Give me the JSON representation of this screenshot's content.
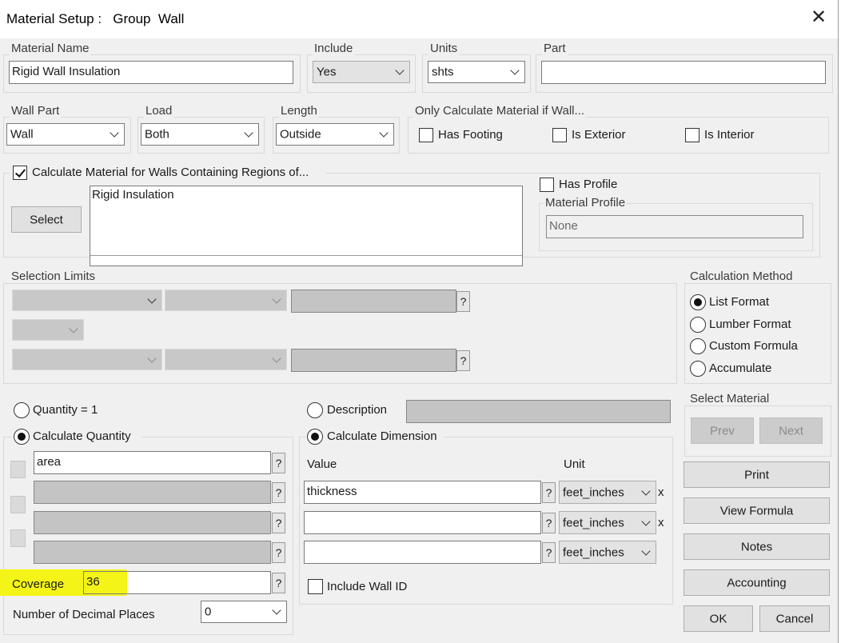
{
  "dialog": {
    "title": "Material Setup :   Group  Wall"
  },
  "material_name": {
    "label": "Material Name",
    "value": "Rigid Wall Insulation"
  },
  "include": {
    "label": "Include",
    "value": "Yes"
  },
  "units": {
    "label": "Units",
    "value": "shts"
  },
  "part": {
    "label": "Part",
    "value": ""
  },
  "wall_part": {
    "label": "Wall Part",
    "value": "Wall"
  },
  "load": {
    "label": "Load",
    "value": "Both"
  },
  "length": {
    "label": "Length",
    "value": "Outside"
  },
  "only_calc": {
    "label": "Only Calculate Material if Wall...",
    "has_footing": {
      "label": "Has Footing",
      "checked": false
    },
    "is_exterior": {
      "label": "Is Exterior",
      "checked": false
    },
    "is_interior": {
      "label": "Is Interior",
      "checked": false
    }
  },
  "regions": {
    "checkbox_label": "Calculate Material for Walls Containing Regions of...",
    "checked": true,
    "select_button": "Select",
    "list_items": [
      "Rigid Insulation"
    ]
  },
  "profile": {
    "has_profile_label": "Has Profile",
    "has_profile_checked": false,
    "material_profile_label": "Material Profile",
    "material_profile_value": "None"
  },
  "selection_limits": {
    "label": "Selection Limits",
    "help": "?"
  },
  "calculation_method": {
    "label": "Calculation Method",
    "options": [
      "List Format",
      "Lumber Format",
      "Custom Formula",
      "Accumulate"
    ],
    "selected": "List Format"
  },
  "quantity": {
    "quantity_one_label": "Quantity = 1",
    "calc_quantity_label": "Calculate Quantity",
    "formula_rows": [
      "area",
      "",
      "",
      ""
    ],
    "help": "?",
    "coverage_label": "Coverage",
    "coverage_value": "36",
    "decimal_label": "Number of Decimal Places",
    "decimal_value": "0"
  },
  "description": {
    "label": "Description",
    "value": ""
  },
  "dimension": {
    "label": "Calculate Dimension",
    "value_header": "Value",
    "unit_header": "Unit",
    "rows": [
      {
        "value": "thickness",
        "unit": "feet_inches",
        "mult": "x"
      },
      {
        "value": "",
        "unit": "feet_inches",
        "mult": "x"
      },
      {
        "value": "",
        "unit": "feet_inches",
        "mult": ""
      }
    ],
    "include_wall_id": "Include Wall ID"
  },
  "select_material": {
    "label": "Select Material",
    "prev": "Prev",
    "next": "Next"
  },
  "buttons": {
    "print": "Print",
    "view_formula": "View Formula",
    "notes": "Notes",
    "accounting": "Accounting",
    "ok": "OK",
    "cancel": "Cancel"
  },
  "colors": {
    "highlight": "#f4f418",
    "dialog_bg": "#f0f0f0",
    "disabled_field": "#c4c4c4"
  }
}
